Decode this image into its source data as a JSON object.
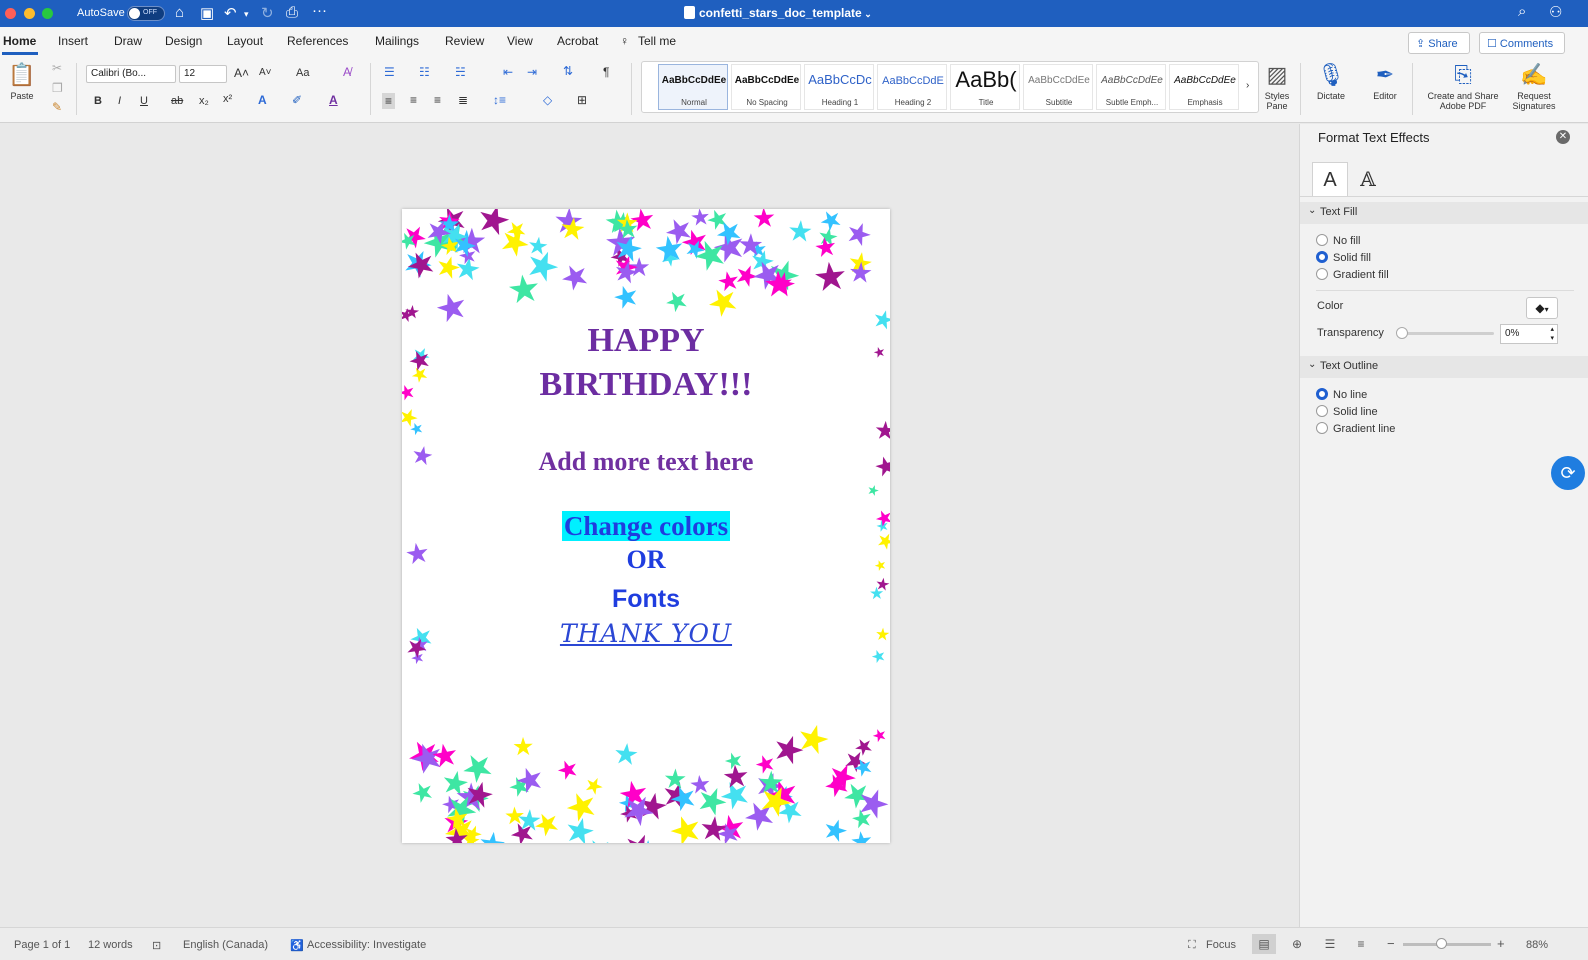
{
  "window": {
    "title": "confetti_stars_doc_template",
    "autosave_label": "AutoSave",
    "autosave_state": "OFF",
    "icons": [
      "home-icon",
      "save-icon",
      "undo-icon",
      "redo-icon",
      "print-icon",
      "more-icon"
    ]
  },
  "tabs": [
    "Home",
    "Insert",
    "Draw",
    "Design",
    "Layout",
    "References",
    "Mailings",
    "Review",
    "View",
    "Acrobat",
    "Tell me"
  ],
  "header_buttons": {
    "share": "Share",
    "comments": "Comments"
  },
  "ribbon": {
    "paste_label": "Paste",
    "font_name": "Calibri (Bo...",
    "font_size": "12",
    "aa_label": "Aa",
    "styles": [
      {
        "sample": "AaBbCcDdEe",
        "name": "Normal"
      },
      {
        "sample": "AaBbCcDdEe",
        "name": "No Spacing"
      },
      {
        "sample": "AaBbCcDc",
        "name": "Heading 1"
      },
      {
        "sample": "AaBbCcDdE",
        "name": "Heading 2"
      },
      {
        "sample": "AaBb(",
        "name": "Title"
      },
      {
        "sample": "AaBbCcDdEe",
        "name": "Subtitle"
      },
      {
        "sample": "AaBbCcDdEe",
        "name": "Subtle Emph..."
      },
      {
        "sample": "AaBbCcDdEe",
        "name": "Emphasis"
      }
    ],
    "styles_pane_label": "Styles Pane",
    "dictate_label": "Dictate",
    "editor_label": "Editor",
    "adobe_label": "Create and Share Adobe PDF",
    "signatures_label": "Request Signatures"
  },
  "document": {
    "line1": "HAPPY",
    "line2": "BIRTHDAY!!!",
    "line3": "Add more text here",
    "line4": "Change colors",
    "line5": "OR",
    "line6": "Fonts",
    "line7": "THANK YOU"
  },
  "format_pane": {
    "title": "Format Text Effects",
    "text_fill_header": "Text Fill",
    "fill_options": [
      "No fill",
      "Solid fill",
      "Gradient fill"
    ],
    "fill_selected": "Solid fill",
    "color_label": "Color",
    "transparency_label": "Transparency",
    "transparency_value": "0%",
    "text_outline_header": "Text Outline",
    "outline_options": [
      "No line",
      "Solid line",
      "Gradient line"
    ],
    "outline_selected": "No line"
  },
  "statusbar": {
    "page": "Page 1 of 1",
    "words": "12 words",
    "language": "English (Canada)",
    "accessibility": "Accessibility: Investigate",
    "focus": "Focus",
    "zoom": "88%"
  },
  "colors": {
    "titlebar": "#1f5fbf",
    "heading_purple": "#6c2da1",
    "accent_blue": "#1f3ddf",
    "highlight_cyan": "#00f0ff",
    "star_palette": [
      "#ff00c8",
      "#fff200",
      "#33c2ff",
      "#9b5cf0",
      "#3ee6a3",
      "#a0168f",
      "#44e0f0"
    ]
  }
}
